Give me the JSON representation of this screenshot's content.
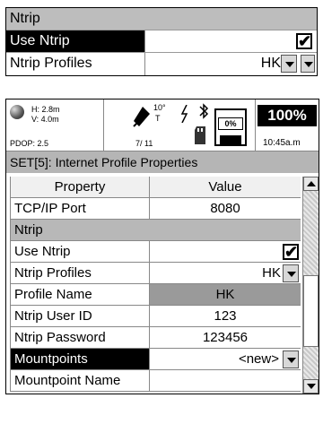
{
  "snippet": {
    "section": "Ntrip",
    "use_ntrip_label": "Use Ntrip",
    "use_ntrip_checked": "✔",
    "profiles_label": "Ntrip Profiles",
    "profiles_value": "HK"
  },
  "status": {
    "h": "H: 2.8m",
    "v": "V: 4.0m",
    "pdop": "PDOP: 2.5",
    "sat_deg": "10°",
    "sat_t": "T",
    "sat_count": "7/ 11",
    "battery_pct": "0%",
    "battery_pct_big": "100%",
    "time": "10:45a.m"
  },
  "title": "SET[5]: Internet Profile Properties",
  "table": {
    "col_property": "Property",
    "col_value": "Value",
    "tcp_label": "TCP/IP Port",
    "tcp_value": "8080",
    "section": "Ntrip",
    "use_ntrip_label": "Use Ntrip",
    "use_ntrip_checked": "✔",
    "profiles_label": "Ntrip Profiles",
    "profiles_value": "HK",
    "profile_name_label": "Profile Name",
    "profile_name_value": "HK",
    "user_label": "Ntrip User ID",
    "user_value": "123",
    "pass_label": "Ntrip Password",
    "pass_value": "123456",
    "mount_label": "Mountpoints",
    "mount_value": "<new>",
    "mount_name_label": "Mountpoint Name"
  }
}
